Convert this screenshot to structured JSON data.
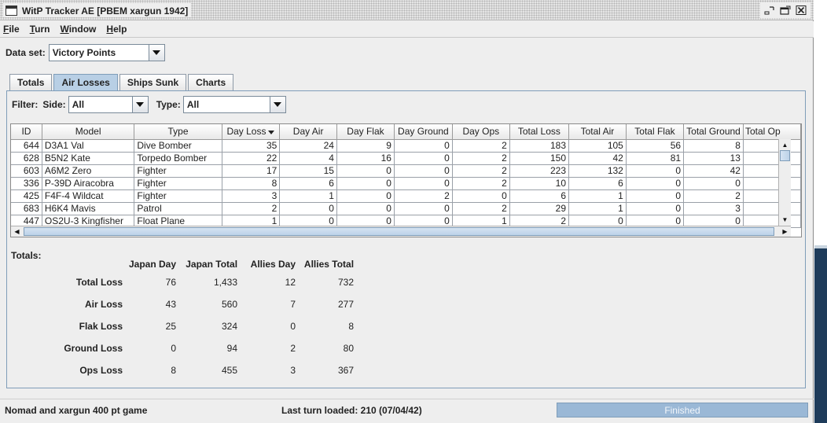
{
  "window": {
    "title": "WitP Tracker AE [PBEM xargun 1942]",
    "controls": [
      "minimize-icon",
      "maximize-icon",
      "close-icon"
    ]
  },
  "menu": [
    {
      "mnemonic": "F",
      "rest": "ile"
    },
    {
      "mnemonic": "T",
      "rest": "urn"
    },
    {
      "mnemonic": "W",
      "rest": "indow"
    },
    {
      "mnemonic": "H",
      "rest": "elp"
    }
  ],
  "dataset": {
    "label": "Data set:",
    "value": "Victory Points"
  },
  "tabs": [
    {
      "label": "Totals",
      "active": false
    },
    {
      "label": "Air Losses",
      "active": true
    },
    {
      "label": "Ships Sunk",
      "active": false
    },
    {
      "label": "Charts",
      "active": false
    }
  ],
  "filter": {
    "label": "Filter:",
    "side_label": "Side:",
    "side_value": "All",
    "type_label": "Type:",
    "type_value": "All"
  },
  "table": {
    "columns": [
      "ID",
      "Model",
      "Type",
      "Day Loss",
      "Day Air",
      "Day Flak",
      "Day Ground",
      "Day Ops",
      "Total Loss",
      "Total Air",
      "Total Flak",
      "Total Ground",
      "Total Op"
    ],
    "sorted_column": "Day Loss",
    "rows": [
      [
        "644",
        "D3A1 Val",
        "Dive Bomber",
        "35",
        "24",
        "9",
        "0",
        "2",
        "183",
        "105",
        "56",
        "8",
        ""
      ],
      [
        "628",
        "B5N2 Kate",
        "Torpedo Bomber",
        "22",
        "4",
        "16",
        "0",
        "2",
        "150",
        "42",
        "81",
        "13",
        ""
      ],
      [
        "603",
        "A6M2 Zero",
        "Fighter",
        "17",
        "15",
        "0",
        "0",
        "2",
        "223",
        "132",
        "0",
        "42",
        ""
      ],
      [
        "336",
        "P-39D Airacobra",
        "Fighter",
        "8",
        "6",
        "0",
        "0",
        "2",
        "10",
        "6",
        "0",
        "0",
        ""
      ],
      [
        "425",
        "F4F-4 Wildcat",
        "Fighter",
        "3",
        "1",
        "0",
        "2",
        "0",
        "6",
        "1",
        "0",
        "2",
        ""
      ],
      [
        "683",
        "H6K4 Mavis",
        "Patrol",
        "2",
        "0",
        "0",
        "0",
        "2",
        "29",
        "1",
        "0",
        "3",
        ""
      ],
      [
        "447",
        "OS2U-3 Kingfisher",
        "Float Plane",
        "1",
        "0",
        "0",
        "0",
        "1",
        "2",
        "0",
        "0",
        "0",
        ""
      ]
    ]
  },
  "totals": {
    "title": "Totals:",
    "columns": [
      "Japan Day",
      "Japan Total",
      "Allies Day",
      "Allies Total"
    ],
    "rows": [
      {
        "label": "Total Loss",
        "values": [
          "76",
          "1,433",
          "12",
          "732"
        ]
      },
      {
        "label": "Air Loss",
        "values": [
          "43",
          "560",
          "7",
          "277"
        ]
      },
      {
        "label": "Flak Loss",
        "values": [
          "25",
          "324",
          "0",
          "8"
        ]
      },
      {
        "label": "Ground Loss",
        "values": [
          "0",
          "94",
          "2",
          "80"
        ]
      },
      {
        "label": "Ops Loss",
        "values": [
          "8",
          "455",
          "3",
          "367"
        ]
      }
    ]
  },
  "status": {
    "left": "Nomad and xargun 400 pt game",
    "middle": "Last turn loaded: 210 (07/04/42)",
    "progress_label": "Finished",
    "progress_fraction": 1.0
  },
  "colors": {
    "active_tab": "#b8cfe5",
    "panel_border": "#7f9db9",
    "progress_fill": "#9ab8d6",
    "desktop_strip": "#1e3b5a"
  }
}
